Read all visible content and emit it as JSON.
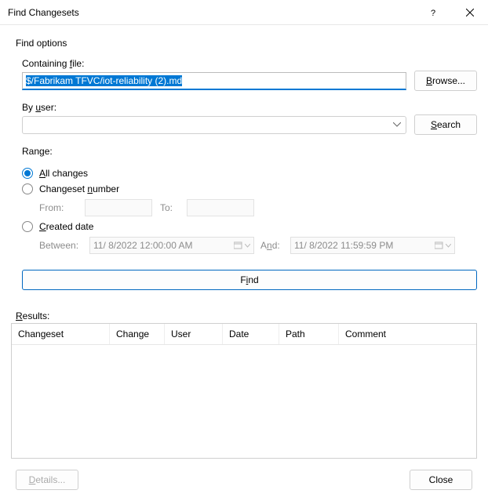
{
  "titlebar": {
    "title": "Find Changesets"
  },
  "group_label": "Find options",
  "containing_file": {
    "label_pre": "Containing ",
    "label_u": "f",
    "label_post": "ile:",
    "value": "$/Fabrikam TFVC/iot-reliability (2).md",
    "browse_pre": "",
    "browse_u": "B",
    "browse_post": "rowse..."
  },
  "by_user": {
    "label_pre": "By ",
    "label_u": "u",
    "label_post": "ser:",
    "value": "",
    "search_pre": "",
    "search_u": "S",
    "search_post": "earch"
  },
  "range": {
    "label_pre": "Ran",
    "label_u": "g",
    "label_post": "e:",
    "all_pre": "",
    "all_u": "A",
    "all_post": "ll changes",
    "num_pre": "Changeset ",
    "num_u": "n",
    "num_post": "umber",
    "from_label": "From:",
    "to_label": "To:",
    "created_pre": "",
    "created_u": "C",
    "created_post": "reated date",
    "between_label": "Between:",
    "between_value": "11/  8/2022 12:00:00 AM",
    "and_pre": "A",
    "and_u": "n",
    "and_post": "d:",
    "and_value": "11/  8/2022 11:59:59 PM"
  },
  "find_btn": {
    "pre": "F",
    "u": "i",
    "post": "nd"
  },
  "results": {
    "label_pre": "",
    "label_u": "R",
    "label_post": "esults:",
    "columns": {
      "changeset": "Changeset",
      "change": "Change",
      "user": "User",
      "date": "Date",
      "path": "Path",
      "comment": "Comment"
    }
  },
  "bottom": {
    "details_pre": "",
    "details_u": "D",
    "details_post": "etails...",
    "close": "Close"
  }
}
